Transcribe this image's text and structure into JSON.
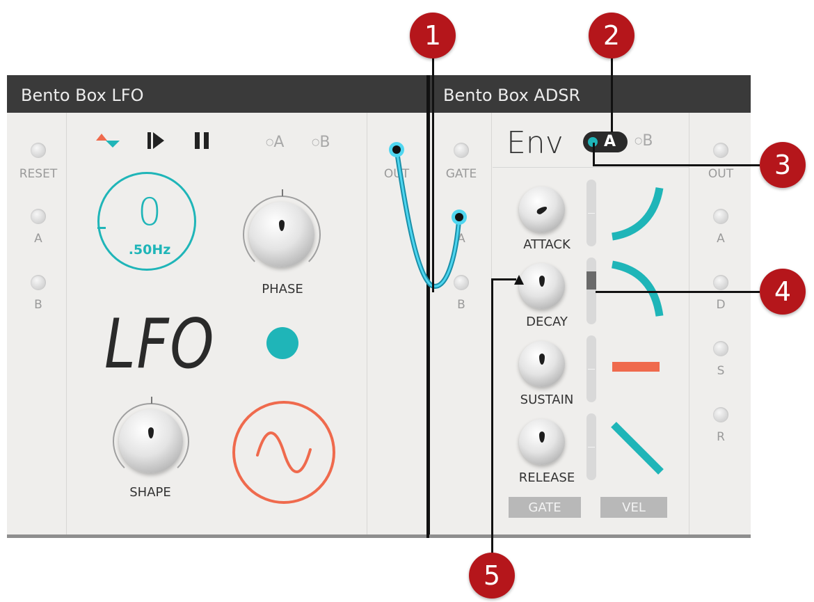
{
  "lfo_module": {
    "title": "Bento Box LFO",
    "inputs": {
      "reset": "RESET",
      "a": "A",
      "b": "B"
    },
    "output": "OUT",
    "controls": {
      "play_icon": "play-icon",
      "pause_icon": "pause-icon",
      "sync_icon": "direction-arrows-icon",
      "option_a": "A",
      "option_b": "B"
    },
    "rate_display": {
      "value": "0",
      "unit": ".50Hz"
    },
    "phase_label": "PHASE",
    "name": "LFO",
    "shape_label": "SHAPE",
    "waveform": "sine-wave-icon"
  },
  "adsr_module": {
    "title": "Bento Box ADSR",
    "inputs": {
      "gate": "GATE",
      "a": "A",
      "b": "B"
    },
    "env_label": "Env",
    "option_a": "A",
    "option_b": "B",
    "knobs": [
      "ATTACK",
      "DECAY",
      "SUSTAIN",
      "RELEASE"
    ],
    "bottom_buttons": {
      "gate": "GATE",
      "vel": "VEL"
    },
    "outputs": {
      "out": "OUT",
      "a": "A",
      "d": "D",
      "s": "S",
      "r": "R"
    }
  },
  "callouts": [
    "1",
    "2",
    "3",
    "4",
    "5"
  ],
  "colors": {
    "accent_teal": "#1fb5b8",
    "accent_coral": "#ef6a4d",
    "badge_red": "#b5161b",
    "title_bar": "#3a3a3a"
  }
}
